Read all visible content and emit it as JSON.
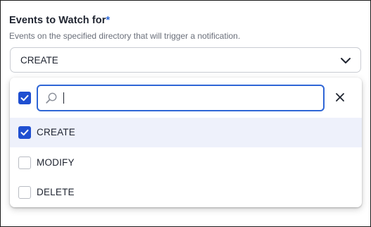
{
  "field": {
    "label": "Events to Watch for",
    "required_marker": "*",
    "helper": "Events on the specified directory that will trigger a notification.",
    "selected_value": "CREATE"
  },
  "dropdown": {
    "select_all_checked": true,
    "search": {
      "value": "",
      "placeholder": ""
    },
    "options": [
      {
        "label": "CREATE",
        "checked": true
      },
      {
        "label": "MODIFY",
        "checked": false
      },
      {
        "label": "DELETE",
        "checked": false
      }
    ]
  },
  "icons": {
    "search": "search-icon",
    "close": "close-icon",
    "chevron": "chevron-down-icon",
    "check": "check-icon"
  },
  "colors": {
    "accent": "#1f4fd1",
    "focus_border": "#2f66d6",
    "selected_row_bg": "#eef1fb"
  }
}
